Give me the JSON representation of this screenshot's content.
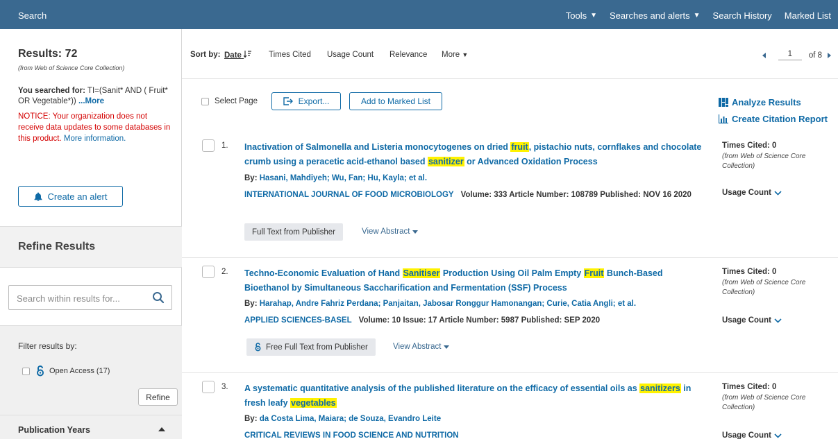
{
  "topbar": {
    "brand": "Search",
    "nav": [
      {
        "label": "Tools",
        "caret": true
      },
      {
        "label": "Searches and alerts",
        "caret": true
      },
      {
        "label": "Search History",
        "caret": false
      },
      {
        "label": "Marked List",
        "caret": false
      }
    ]
  },
  "sidebar": {
    "results_title": "Results: 72",
    "results_source": "(from Web of Science Core Collection)",
    "searched_label": "You searched for:",
    "searched_query": "TI=(Sanit* AND ( Fruit* OR Vegetable*))",
    "searched_more": "...More",
    "notice": "NOTICE: Your organization does not receive data updates to some databases in this product.",
    "notice_link": "More information.",
    "alert_button": "Create an alert",
    "refine_title": "Refine Results",
    "search_placeholder": "Search within results for...",
    "filter_label": "Filter results by:",
    "open_access": "Open Access (17)",
    "refine_button": "Refine",
    "pub_years": "Publication Years"
  },
  "sortbar": {
    "label": "Sort by:",
    "options": [
      "Date",
      "Times Cited",
      "Usage Count",
      "Relevance",
      "More"
    ],
    "active": "Date",
    "page_current": "1",
    "page_total": "of 8"
  },
  "toolbar": {
    "select_page": "Select Page",
    "export": "Export...",
    "add_marked": "Add to Marked List",
    "analyze": "Analyze Results",
    "citation_report": "Create Citation Report"
  },
  "records": [
    {
      "num": "1.",
      "title_parts": [
        {
          "t": "Inactivation of Salmonella and Listeria monocytogenes on dried "
        },
        {
          "t": "fruit",
          "hl": true
        },
        {
          "t": ", pistachio nuts, cornflakes and chocolate crumb using a peracetic acid-ethanol based "
        },
        {
          "t": "sanitizer",
          "hl": true
        },
        {
          "t": " or Advanced Oxidation Process"
        }
      ],
      "by": "By:",
      "authors": "Hasani, Mahdiyeh; Wu, Fan; Hu, Kayla; et al.",
      "journal": "INTERNATIONAL JOURNAL OF FOOD MICROBIOLOGY",
      "meta": "Volume: 333    Article Number: 108789  Published:  NOV 16 2020",
      "fulltext": "Full Text from Publisher",
      "fulltext_oa": false,
      "abstract": "View Abstract",
      "times_cited": "Times Cited: 0",
      "cited_source": "(from Web of Science Core Collection)",
      "usage": "Usage Count"
    },
    {
      "num": "2.",
      "title_parts": [
        {
          "t": "Techno-Economic Evaluation of Hand "
        },
        {
          "t": "Sanitiser",
          "hl": true
        },
        {
          "t": " Production Using Oil Palm Empty "
        },
        {
          "t": "Fruit",
          "hl": true
        },
        {
          "t": " Bunch-Based Bioethanol by Simultaneous Saccharification and Fermentation (SSF) Process"
        }
      ],
      "by": "By:",
      "authors": "Harahap, Andre Fahriz Perdana; Panjaitan, Jabosar Ronggur Hamonangan; Curie, Catia Angli; et al.",
      "journal": "APPLIED SCIENCES-BASEL",
      "meta": "Volume: 10   Issue: 17    Article Number: 5987  Published:  SEP 2020",
      "fulltext": "Free Full Text from Publisher",
      "fulltext_oa": true,
      "abstract": "View Abstract",
      "times_cited": "Times Cited: 0",
      "cited_source": "(from Web of Science Core Collection)",
      "usage": "Usage Count"
    },
    {
      "num": "3.",
      "title_parts": [
        {
          "t": "A systematic quantitative analysis of the published literature on the efficacy of essential oils as "
        },
        {
          "t": "sanitizers",
          "hl": true
        },
        {
          "t": " in fresh leafy "
        },
        {
          "t": "vegetables",
          "hl": true
        }
      ],
      "by": "By:",
      "authors": "da Costa Lima, Maiara; de Souza, Evandro Leite",
      "journal": "CRITICAL REVIEWS IN FOOD SCIENCE AND NUTRITION",
      "meta": "",
      "times_cited": "Times Cited: 0",
      "cited_source": "(from Web of Science Core Collection)",
      "usage": "Usage Count"
    }
  ]
}
